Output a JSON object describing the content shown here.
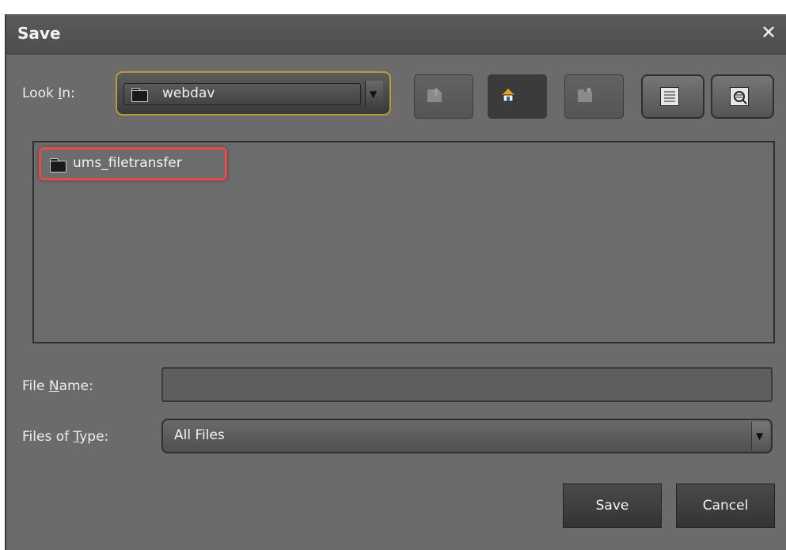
{
  "dialog": {
    "title": "Save",
    "close_symbol": "✕"
  },
  "look_in": {
    "label_pre": "Look ",
    "label_mnemonic": "I",
    "label_post": "n:",
    "value": "webdav"
  },
  "toolbar": {
    "up_icon": "folder-up-icon",
    "home_icon": "home-icon",
    "new_folder_icon": "new-folder-icon",
    "list_icon": "list-view-icon",
    "details_icon": "details-view-icon"
  },
  "files": [
    {
      "name": "ums_filetransfer",
      "type": "folder"
    }
  ],
  "file_name": {
    "label_pre": "File ",
    "label_mnemonic": "N",
    "label_post": "ame:",
    "value": ""
  },
  "file_type": {
    "label_pre": "Files of ",
    "label_mnemonic": "T",
    "label_post": "ype:",
    "value": "All Files"
  },
  "buttons": {
    "save": "Save",
    "cancel": "Cancel"
  },
  "colors": {
    "dialog_bg": "#6b6b6b",
    "highlight": "#e84a4a",
    "combo_border": "#b89a3a"
  }
}
